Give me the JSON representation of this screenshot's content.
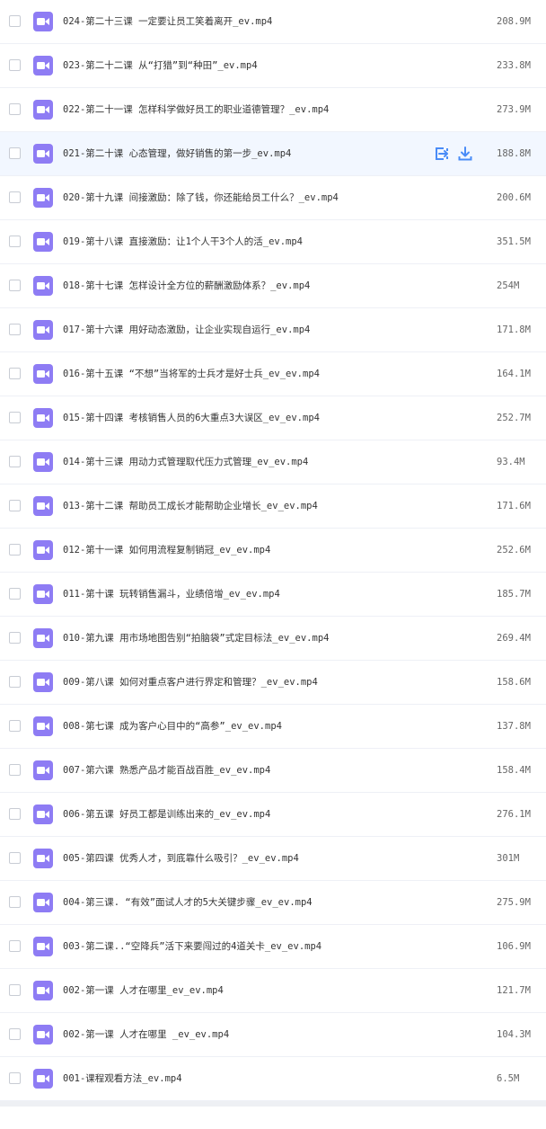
{
  "files": [
    {
      "name": "024-第二十三课 一定要让员工笑着离开_ev.mp4",
      "size": "208.9M"
    },
    {
      "name": "023-第二十二课 从“打猎”到“种田”_ev.mp4",
      "size": "233.8M"
    },
    {
      "name": "022-第二十一课 怎样科学做好员工的职业道德管理？_ev.mp4",
      "size": "273.9M"
    },
    {
      "name": "021-第二十课 心态管理，做好销售的第一步_ev.mp4",
      "size": "188.8M"
    },
    {
      "name": "020-第十九课 间接激励：除了钱，你还能给员工什么？_ev.mp4",
      "size": "200.6M"
    },
    {
      "name": "019-第十八课 直接激励：让1个人干3个人的活_ev.mp4",
      "size": "351.5M"
    },
    {
      "name": "018-第十七课 怎样设计全方位的薪酬激励体系？_ev.mp4",
      "size": "254M"
    },
    {
      "name": "017-第十六课 用好动态激励，让企业实现自运行_ev.mp4",
      "size": "171.8M"
    },
    {
      "name": "016-第十五课 “不想”当将军的士兵才是好士兵_ev_ev.mp4",
      "size": "164.1M"
    },
    {
      "name": "015-第十四课 考核销售人员的6大重点3大误区_ev_ev.mp4",
      "size": "252.7M"
    },
    {
      "name": "014-第十三课 用动力式管理取代压力式管理_ev_ev.mp4",
      "size": "93.4M"
    },
    {
      "name": "013-第十二课 帮助员工成长才能帮助企业增长_ev_ev.mp4",
      "size": "171.6M"
    },
    {
      "name": "012-第十一课 如何用流程复制销冠_ev_ev.mp4",
      "size": "252.6M"
    },
    {
      "name": "011-第十课 玩转销售漏斗，业绩倍增_ev_ev.mp4",
      "size": "185.7M"
    },
    {
      "name": "010-第九课 用市场地图告别“拍脑袋”式定目标法_ev_ev.mp4",
      "size": "269.4M"
    },
    {
      "name": "009-第八课 如何对重点客户进行界定和管理？_ev_ev.mp4",
      "size": "158.6M"
    },
    {
      "name": "008-第七课 成为客户心目中的“高参”_ev_ev.mp4",
      "size": "137.8M"
    },
    {
      "name": "007-第六课 熟悉产品才能百战百胜_ev_ev.mp4",
      "size": "158.4M"
    },
    {
      "name": "006-第五课 好员工都是训练出来的_ev_ev.mp4",
      "size": "276.1M"
    },
    {
      "name": "005-第四课 优秀人才，到底靠什么吸引？_ev_ev.mp4",
      "size": "301M"
    },
    {
      "name": "004-第三课. “有效”面试人才的5大关键步骤_ev_ev.mp4",
      "size": "275.9M"
    },
    {
      "name": "003-第二课..“空降兵”活下来要闯过的4道关卡_ev_ev.mp4",
      "size": "106.9M"
    },
    {
      "name": "002-第一课 人才在哪里_ev_ev.mp4",
      "size": "121.7M"
    },
    {
      "name": "002-第一课 人才在哪里 _ev_ev.mp4",
      "size": "104.3M"
    },
    {
      "name": "001-课程观看方法_ev.mp4",
      "size": "6.5M"
    }
  ],
  "hovered_row": 3,
  "row_actions": [
    {
      "icon": "move-to-icon"
    },
    {
      "icon": "download-icon"
    }
  ],
  "colors": {
    "accent": "#4a8cf7",
    "video_icon": "#8e7cf4",
    "hover_row": "#f2f7ff"
  }
}
